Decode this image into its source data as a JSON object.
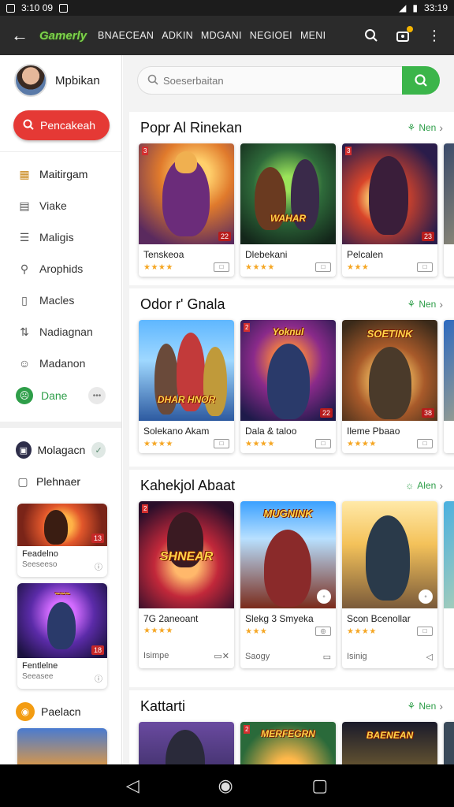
{
  "status": {
    "left_text": "3:10 09",
    "right_text": "33:19"
  },
  "appbar": {
    "brand": "Gamerly",
    "nav": [
      "BNAECEAN",
      "ADKIN",
      "MDGANI",
      "NEGIOEI",
      "MENI"
    ]
  },
  "sidebar": {
    "profile_name": "Mpbikan",
    "search_button": "Pencakeah",
    "items": [
      {
        "label": "Maitirgam",
        "icon": "grid-icon"
      },
      {
        "label": "Viake",
        "icon": "list-icon"
      },
      {
        "label": "Maligis",
        "icon": "doc-icon"
      },
      {
        "label": "Arophids",
        "icon": "search-icon"
      },
      {
        "label": "Macles",
        "icon": "bookmark-icon"
      },
      {
        "label": "Nadiagnan",
        "icon": "swap-icon"
      },
      {
        "label": "Madanon",
        "icon": "chat-icon"
      }
    ],
    "dare_label": "Dane",
    "mode_label": "Molagacn",
    "pending_label": "Plehnaer",
    "cards": [
      {
        "title": "Feadelno",
        "sub": "Seeseeso"
      },
      {
        "title": "Fentlelne",
        "sub": "Seeasee"
      }
    ],
    "promo_label": "Paelacn"
  },
  "search": {
    "placeholder": "Soeserbaitan"
  },
  "sections": [
    {
      "title": "Popr Al Rinekan",
      "more": "Nen",
      "cards": [
        {
          "name": "Tenskeoa",
          "badge": "22"
        },
        {
          "name": "Dlebekani",
          "badge": ""
        },
        {
          "name": "Pelcalen",
          "badge": "23"
        }
      ]
    },
    {
      "title": "Odor r' Gnala",
      "more": "Nen",
      "cards": [
        {
          "name": "Solekano Akam",
          "badge": ""
        },
        {
          "name": "Dala & taloo",
          "badge": "22"
        },
        {
          "name": "Ileme Pbaao",
          "badge": "38"
        }
      ]
    },
    {
      "title": "Kahekjol Abaat",
      "more": "Alen",
      "cards": [
        {
          "name": "7G 2aneoant",
          "foot": "Isimpe"
        },
        {
          "name": "Slekg 3 Smyeka",
          "foot": "Saogy"
        },
        {
          "name": "Scon Bcenollar",
          "foot": "Isinig"
        }
      ]
    },
    {
      "title": "Kattarti",
      "more": "Nen"
    }
  ],
  "colors": {
    "accent_green": "#3bb54a",
    "accent_red": "#e53935",
    "appbar": "#2b2b2b"
  }
}
